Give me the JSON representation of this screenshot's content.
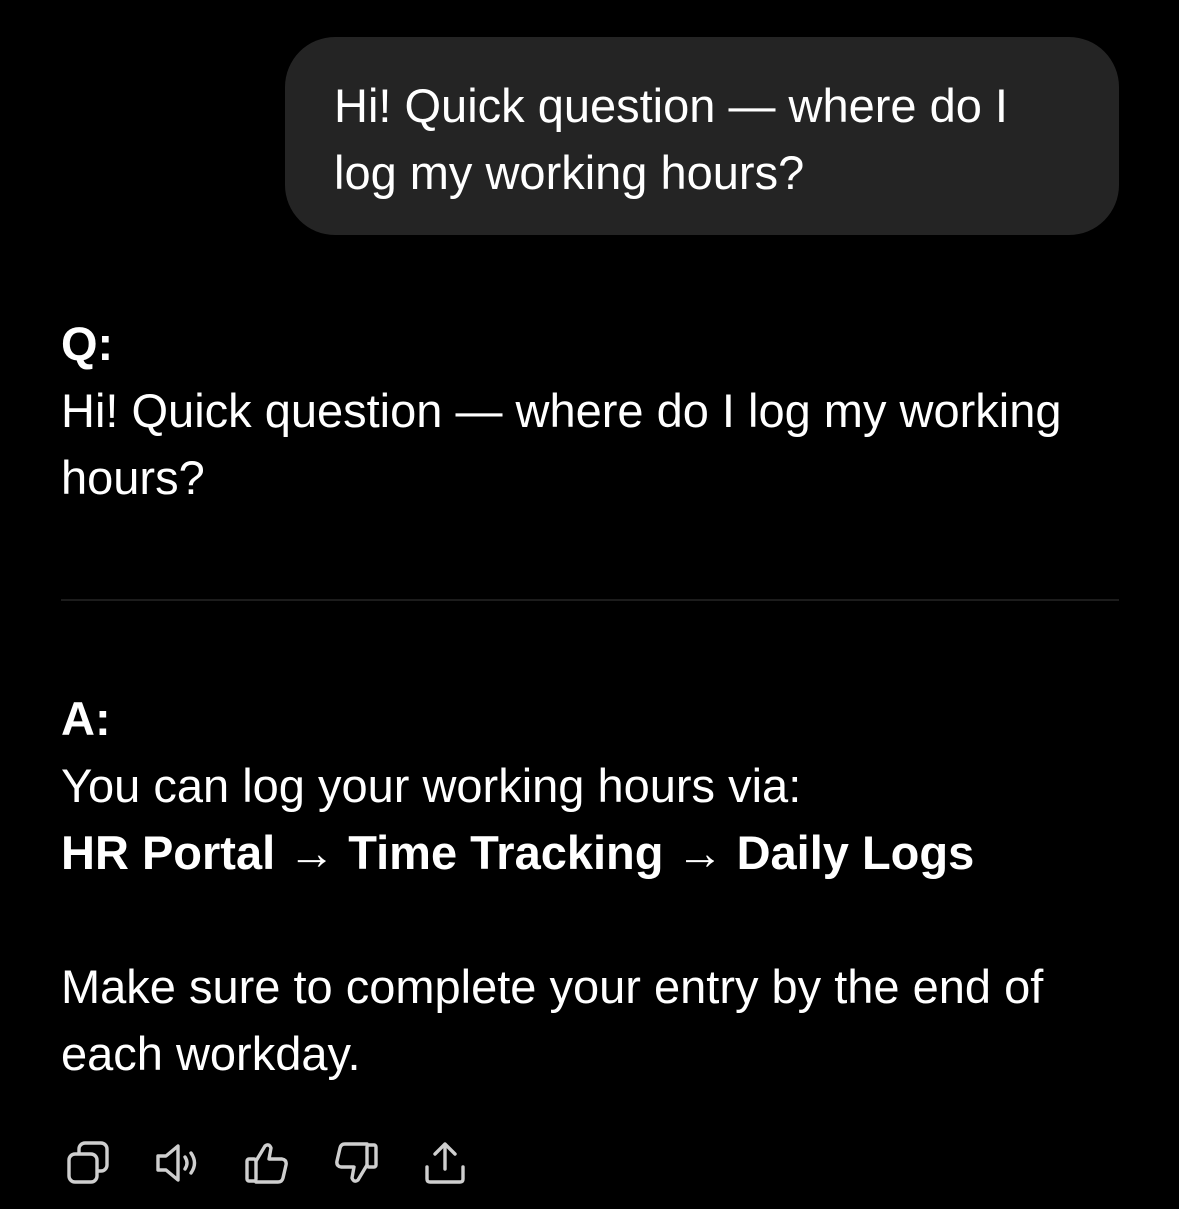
{
  "user_message": {
    "text": "Hi! Quick question — where do I log my working hours?"
  },
  "answer_card": {
    "q_label": "Q:",
    "q_text": "Hi! Quick question — where do I log my working hours?",
    "a_label": "A:",
    "a_intro": "You can log your working hours via:",
    "a_path": "HR Portal → Time Tracking → Daily Logs",
    "a_note": "Make sure to complete your entry by the end of each workday."
  },
  "actions": [
    {
      "icon": "copy-icon"
    },
    {
      "icon": "read-aloud-icon"
    },
    {
      "icon": "thumbs-up-icon"
    },
    {
      "icon": "thumbs-down-icon"
    },
    {
      "icon": "share-icon"
    }
  ],
  "colors": {
    "background": "#000000",
    "bubble": "#242424",
    "text": "#ffffff",
    "icon": "#cfcfcf",
    "divider": "#1c1c1c"
  }
}
